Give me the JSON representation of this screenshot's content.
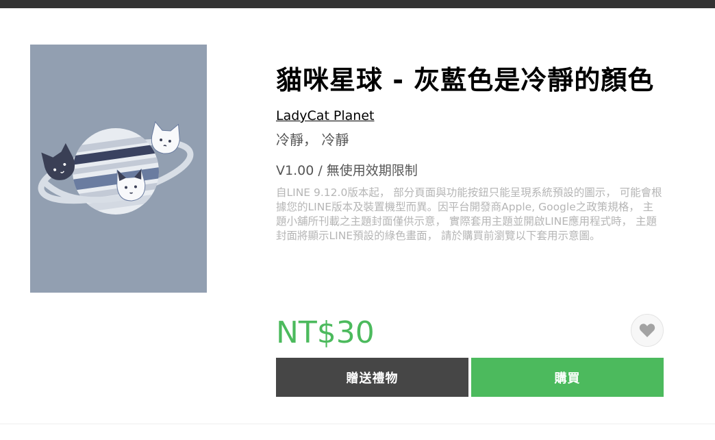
{
  "product": {
    "title": "貓咪星球 - 灰藍色是冷靜的顏色",
    "author": "LadyCat Planet",
    "tags": "冷靜， 冷靜",
    "version": "V1.00 / 無使用效期限制",
    "notice": "自LINE 9.12.0版本起， 部分頁面與功能按鈕只能呈現系統預設的圖示， 可能會根據您的LINE版本及裝置機型而異。因平台開發商Apple, Google之政策規格， 主題小舖所刊載之主題封面僅供示意， 實際套用主題並開啟LINE應用程式時， 主題封面將顯示LINE預設的綠色畫面， 請於購買前瀏覽以下套用示意圖。",
    "price": "NT$30"
  },
  "buttons": {
    "gift_label": "贈送禮物",
    "buy_label": "購買"
  },
  "icons": {
    "favorite": "heart-icon",
    "thumbnail": "cat-planet-illustration"
  },
  "colors": {
    "price": "#4cba5d",
    "buy_button": "#4cba5d",
    "gift_button": "#464646",
    "thumbnail_bg": "#929fb1"
  }
}
